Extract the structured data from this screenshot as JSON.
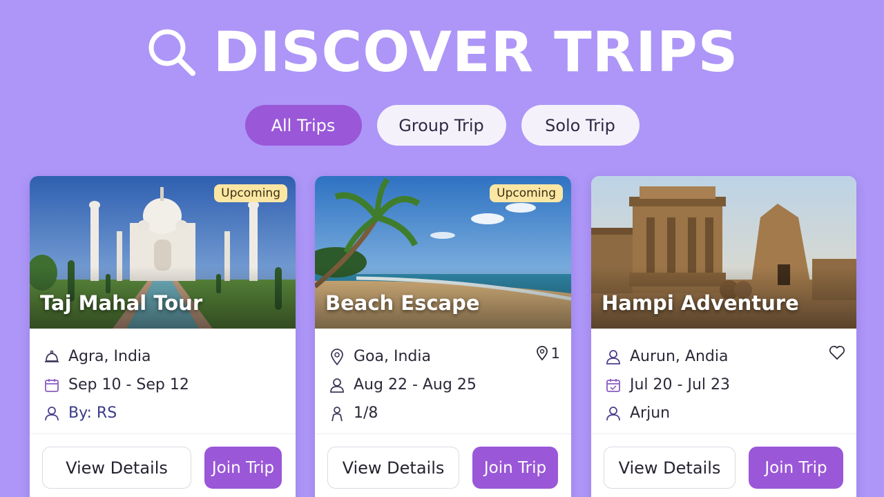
{
  "header": {
    "title": "DISCOVER TRIPS",
    "icon": "search-icon"
  },
  "filters": [
    {
      "label": "All Trips",
      "active": true
    },
    {
      "label": "Group Trip",
      "active": false
    },
    {
      "label": "Solo Trip",
      "active": false
    }
  ],
  "colors": {
    "background": "#ad96f7",
    "accent": "#9a57d8",
    "badge": "#fbe7a3"
  },
  "trips": [
    {
      "title": "Taj Mahal Tour",
      "badge": "Upcoming",
      "location": "Agra, India",
      "location_icon": "bell-icon",
      "dates": "Sep 10 - Sep 12",
      "dates_icon": "calendar-icon",
      "third": "By: RS",
      "third_icon": "user-icon",
      "view_label": "View Details",
      "join_label": "Join Trip",
      "image": "taj-mahal-photo"
    },
    {
      "title": "Beach Escape",
      "badge": "Upcoming",
      "location": "Goa, India",
      "location_icon": "map-pin-icon",
      "dates": "Aug 22 - Aug 25",
      "dates_icon": "user-icon",
      "third": "1/8",
      "third_icon": "person-icon",
      "corner_count": "1",
      "corner_icon": "map-pin-icon",
      "view_label": "View Details",
      "join_label": "Join Trip",
      "image": "beach-photo"
    },
    {
      "title": "Hampi Adventure",
      "location": "Aurun, Andia",
      "location_icon": "user-icon",
      "dates": "Jul 20 - Jul 23",
      "dates_icon": "calendar-icon",
      "third": "Arjun",
      "third_icon": "user-icon",
      "corner_icon": "heart-icon",
      "view_label": "View Details",
      "join_label": "Join Trip",
      "image": "hampi-temple-photo"
    }
  ]
}
